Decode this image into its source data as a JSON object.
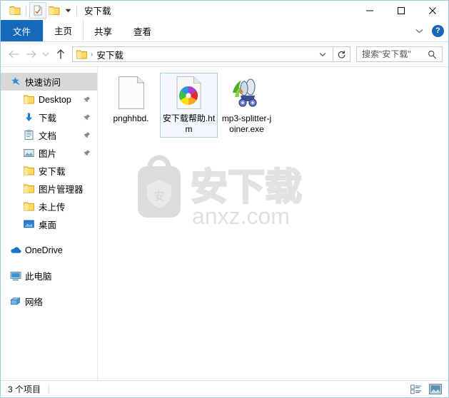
{
  "window": {
    "title": "安下载",
    "quick_access": [
      {
        "name": "folder-icon",
        "label": "文件夹"
      },
      {
        "name": "properties-icon",
        "label": "属性"
      },
      {
        "name": "new-folder-icon",
        "label": "新建文件夹"
      },
      {
        "name": "chevron-down-icon",
        "label": "自定义快速访问工具栏"
      }
    ],
    "controls": {
      "minimize": "最小化",
      "maximize": "最大化",
      "close": "关闭"
    }
  },
  "ribbon": {
    "tabs": [
      {
        "label": "文件",
        "active": false,
        "style": "file"
      },
      {
        "label": "主页",
        "active": true,
        "style": "normal"
      },
      {
        "label": "共享",
        "active": false,
        "style": "normal"
      },
      {
        "label": "查看",
        "active": false,
        "style": "normal"
      }
    ],
    "collapse_label": "展开功能区",
    "help_label": "?"
  },
  "addressbar": {
    "back_label": "后退",
    "forward_label": "前进",
    "recent_label": "最近浏览的位置",
    "up_label": "上移一级",
    "breadcrumb": [
      "安下载"
    ],
    "breadcrumb_separator": "›",
    "dropdown_label": "以前的位置",
    "refresh_label": "刷新",
    "search": {
      "placeholder": "搜索\"安下载\"",
      "value": "",
      "icon": "search-icon"
    }
  },
  "sidebar": {
    "items": [
      {
        "label": "快速访问",
        "icon": "star-pin-icon",
        "selected": true,
        "level": "root",
        "pinned": false
      },
      {
        "label": "Desktop",
        "icon": "folder-icon",
        "selected": false,
        "level": "child",
        "pinned": true
      },
      {
        "label": "下载",
        "icon": "download-arrow-icon",
        "selected": false,
        "level": "child",
        "pinned": true
      },
      {
        "label": "文档",
        "icon": "documents-icon",
        "selected": false,
        "level": "child",
        "pinned": true
      },
      {
        "label": "图片",
        "icon": "pictures-icon",
        "selected": false,
        "level": "child",
        "pinned": true
      },
      {
        "label": "安下载",
        "icon": "folder-icon",
        "selected": false,
        "level": "child",
        "pinned": false
      },
      {
        "label": "图片管理器",
        "icon": "folder-icon",
        "selected": false,
        "level": "child",
        "pinned": false
      },
      {
        "label": "未上传",
        "icon": "folder-icon",
        "selected": false,
        "level": "child",
        "pinned": false
      },
      {
        "label": "桌面",
        "icon": "desktop-icon",
        "selected": false,
        "level": "child",
        "pinned": false
      }
    ],
    "roots": [
      {
        "label": "OneDrive",
        "icon": "onedrive-cloud-icon"
      },
      {
        "label": "此电脑",
        "icon": "this-pc-icon"
      },
      {
        "label": "网络",
        "icon": "network-icon"
      }
    ]
  },
  "files": [
    {
      "name": "pnghhbd.",
      "icon": "blank-document-icon",
      "selected": false
    },
    {
      "name": "安下载帮助.htm",
      "icon": "chrome-html-icon",
      "selected": true
    },
    {
      "name": "mp3-splitter-joiner.exe",
      "icon": "mp3-splitter-app-icon",
      "selected": false
    }
  ],
  "watermark": {
    "badge_text": "安",
    "title_text": "安下载",
    "site_text": "anxz.com"
  },
  "statusbar": {
    "item_count": "3 个项目",
    "views": [
      {
        "name": "details-view-button",
        "label": "详细信息",
        "active": false
      },
      {
        "name": "large-icons-view-button",
        "label": "大图标",
        "active": true
      }
    ]
  },
  "colors": {
    "accent": "#1668b8",
    "selection_border": "#a8cfe8",
    "selection_fill": "#f2f8fd",
    "folder_yellow": "#ffd966",
    "window_border": "#9ecbe0"
  }
}
